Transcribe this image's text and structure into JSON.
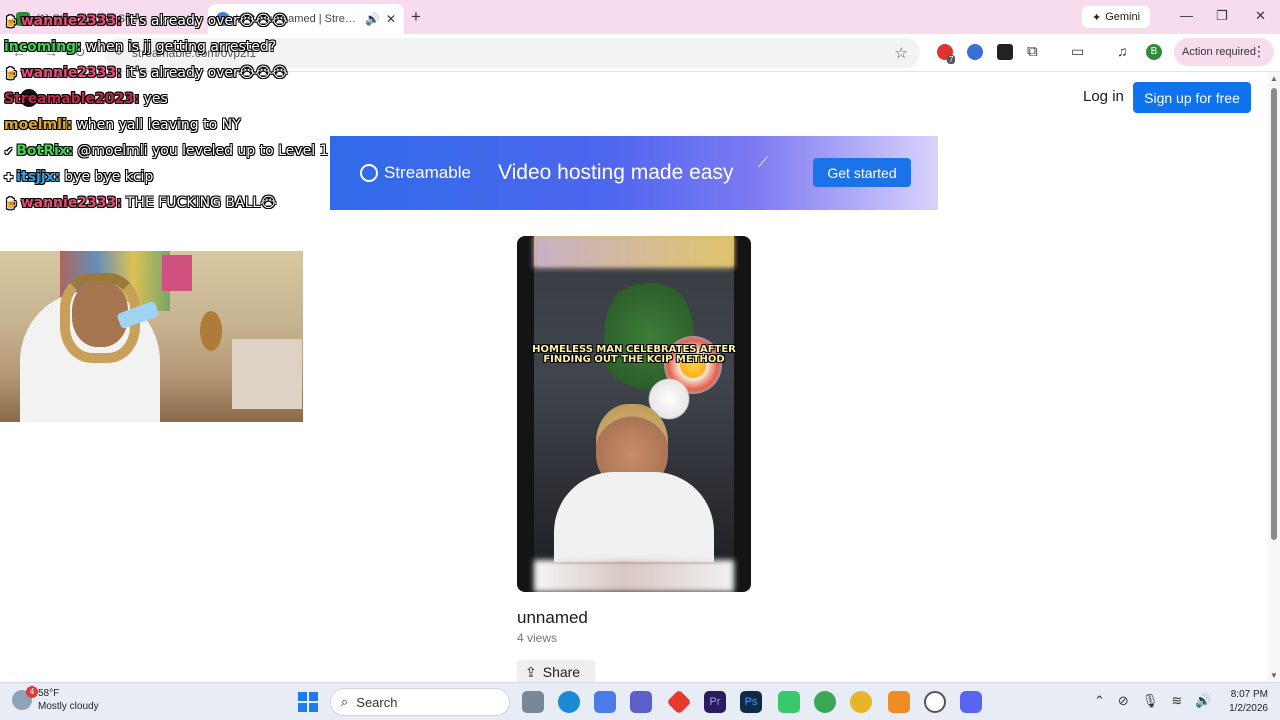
{
  "browser": {
    "tabs": [
      {
        "title": "(1) Streamable | Stre...",
        "active": false
      },
      {
        "title": "Watch unnamed | Streamable",
        "active": true
      }
    ],
    "new_tab_icon": "plus-icon",
    "gemini_label": "Gemini",
    "url": "streamable.com/ovp2i1",
    "extension_badge": "7",
    "profile_initial": "B",
    "action_required_label": "Action required"
  },
  "page": {
    "login_label": "Log in",
    "signup_label": "Sign up for free",
    "banner": {
      "brand": "Streamable",
      "tagline": "Video hosting made easy",
      "cta": "Get started"
    },
    "video": {
      "caption": "HOMELESS MAN CELEBRATES AFTER FINDING OUT THE KCIP METHOD",
      "title": "unnamed",
      "views": "4 views",
      "share_label": "Share"
    }
  },
  "overlay": {
    "chat": [
      {
        "user": "wannie2333:",
        "message": "it's already over😭😭😭",
        "user_color": "#e64d7a",
        "badge": "🍺"
      },
      {
        "user": "incoming:",
        "message": "when is jj getting arrested?",
        "user_color": "#3bd64b",
        "badge": ""
      },
      {
        "user": "wannie2333:",
        "message": "it's already over😭😭😭",
        "user_color": "#e64d7a",
        "badge": "🍺"
      },
      {
        "user": "Streamable2023:",
        "message": "yes",
        "user_color": "#c02a4a",
        "badge": ""
      },
      {
        "user": "moelmli:",
        "message": "when yall leaving to NY",
        "user_color": "#e0a820",
        "badge": ""
      },
      {
        "user": "BotRix:",
        "message": "@moelmli you leveled up to Level 1",
        "user_color": "#3bd64b",
        "badge": "✔"
      },
      {
        "user": "itsjjx:",
        "message": "bye bye kcip",
        "user_color": "#28a7e8",
        "badge": "✚"
      },
      {
        "user": "wannie2333:",
        "message": "THE FUCKING BALL😭",
        "user_color": "#e64d7a",
        "badge": "🍺"
      }
    ]
  },
  "taskbar": {
    "weather_temp": "58°F",
    "weather_desc": "Mostly cloudy",
    "weather_badge": "4",
    "search_label": "Search",
    "time": "8:07 PM",
    "date": "1/2/2026"
  }
}
